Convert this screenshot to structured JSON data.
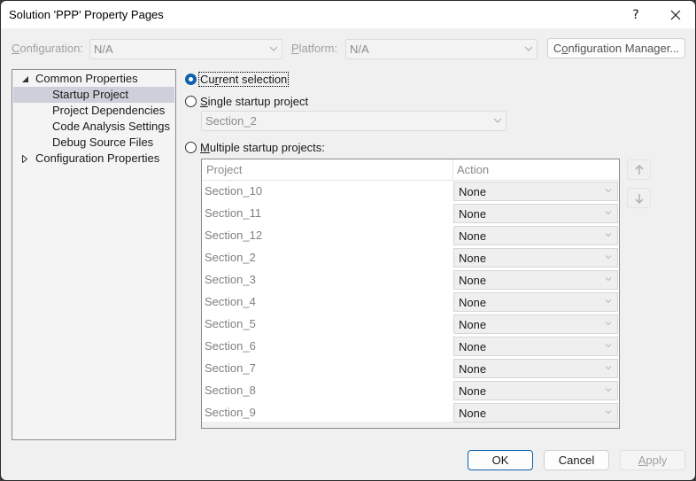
{
  "window": {
    "title": "Solution 'PPP' Property Pages",
    "help_label": "?",
    "close_icon": "close-icon"
  },
  "toolbar": {
    "configuration_label_prefix": "",
    "configuration_label_mnemonic": "C",
    "configuration_label_rest": "onfiguration:",
    "configuration_value": "N/A",
    "platform_label_mnemonic": "P",
    "platform_label_rest": "latform:",
    "platform_value": "N/A",
    "config_manager_pre": "C",
    "config_manager_mnemonic": "o",
    "config_manager_rest": "nfiguration Manager..."
  },
  "tree": {
    "items": [
      {
        "label": "Common Properties",
        "expander": "expanded",
        "level": 0
      },
      {
        "label": "Startup Project",
        "level": 1,
        "selected": true
      },
      {
        "label": "Project Dependencies",
        "level": 1
      },
      {
        "label": "Code Analysis Settings",
        "level": 1
      },
      {
        "label": "Debug Source Files",
        "level": 1
      },
      {
        "label": "Configuration Properties",
        "expander": "collapsed",
        "level": 0
      }
    ]
  },
  "startup": {
    "current_selection": {
      "pre": "Cu",
      "mnemonic": "r",
      "rest": "rent selection",
      "checked": true
    },
    "single": {
      "pre": "",
      "mnemonic": "S",
      "rest": "ingle startup project",
      "checked": false
    },
    "single_value": "Section_2",
    "multiple": {
      "pre": "",
      "mnemonic": "M",
      "rest": "ultiple startup projects:",
      "checked": false
    }
  },
  "grid": {
    "columns": [
      "Project",
      "Action"
    ],
    "rows": [
      {
        "project": "Section_10",
        "action": "None"
      },
      {
        "project": "Section_11",
        "action": "None"
      },
      {
        "project": "Section_12",
        "action": "None"
      },
      {
        "project": "Section_2",
        "action": "None"
      },
      {
        "project": "Section_3",
        "action": "None"
      },
      {
        "project": "Section_4",
        "action": "None"
      },
      {
        "project": "Section_5",
        "action": "None"
      },
      {
        "project": "Section_6",
        "action": "None"
      },
      {
        "project": "Section_7",
        "action": "None"
      },
      {
        "project": "Section_8",
        "action": "None"
      },
      {
        "project": "Section_9",
        "action": "None"
      }
    ],
    "move_up_icon": "arrow-up-icon",
    "move_down_icon": "arrow-down-icon"
  },
  "footer": {
    "ok_label": "OK",
    "cancel_label": "Cancel",
    "apply_mnemonic": "A",
    "apply_rest": "pply"
  },
  "colors": {
    "accent": "#0f5fab",
    "selection": "#cdcfda",
    "disabled_text": "#a0a0a0"
  }
}
